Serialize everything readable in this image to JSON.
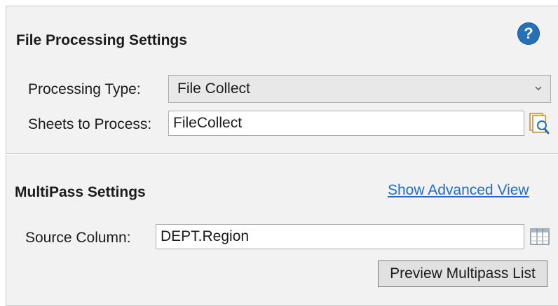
{
  "file_processing": {
    "title": "File Processing Settings",
    "help_icon": "?",
    "processing_type_label": "Processing Type:",
    "processing_type_value": "File Collect",
    "sheets_label": "Sheets to Process:",
    "sheets_value": "FileCollect"
  },
  "multipass": {
    "title": "MultiPass Settings",
    "advanced_link": "Show Advanced View",
    "source_column_label": "Source Column:",
    "source_column_value": "DEPT.Region",
    "preview_button": "Preview Multipass List"
  },
  "icons": {
    "help": "help-icon",
    "dropdown": "chevron-down-icon",
    "sheet_browse": "document-search-icon",
    "column_picker": "table-columns-icon"
  },
  "colors": {
    "panel_background": "#f2f2f2",
    "help_icon": "#2670b8",
    "link": "#1a6fd1"
  }
}
